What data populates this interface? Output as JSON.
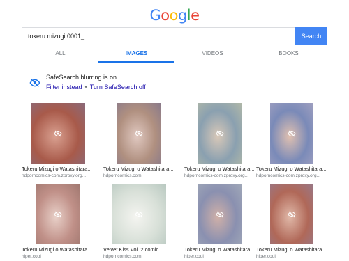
{
  "logo": {
    "letters": [
      "G",
      "o",
      "o",
      "g",
      "l",
      "e"
    ],
    "colors": [
      "#4285f4",
      "#ea4335",
      "#fbbc05",
      "#4285f4",
      "#34a853",
      "#ea4335"
    ]
  },
  "search": {
    "query": "tokeru mizugi 0001_",
    "button_label": "Search"
  },
  "tabs": [
    {
      "label": "ALL"
    },
    {
      "label": "IMAGES"
    },
    {
      "label": "VIDEOS"
    },
    {
      "label": "BOOKS"
    }
  ],
  "safesearch": {
    "title": "SafeSearch blurring is on",
    "filter_link": "Filter instead",
    "separator": "•",
    "turn_off_link": "Turn SafeSearch off"
  },
  "results": [
    {
      "title": "Tokeru Mizugi o Watashitara...",
      "source": "hdporncomics-com.zproxy.org...",
      "colors": [
        "#a85a4a",
        "#d9a090",
        "#8a6a7a"
      ]
    },
    {
      "title": "Tokeru Mizugi o Watashitara...",
      "source": "hdporncomics.com",
      "colors": [
        "#b09080",
        "#e0c8c0",
        "#8a7a8a"
      ]
    },
    {
      "title": "Tokeru Mizugi o Watashitara...",
      "source": "hdporncomics-com.zproxy.org...",
      "colors": [
        "#8aa0b0",
        "#d8c8b8",
        "#b0b8a8"
      ]
    },
    {
      "title": "Tokeru Mizugi o Watashitara...",
      "source": "hdporncomics-com.zproxy.org...",
      "colors": [
        "#7a8ab8",
        "#e0c0b0",
        "#a0a0c0"
      ]
    },
    {
      "title": "Tokeru Mizugi o Watashitara...",
      "source": "hiper.cool",
      "colors": [
        "#c09088",
        "#e8d0c8",
        "#a07870"
      ]
    },
    {
      "title": "Velvet Kiss Vol. 2 comic...",
      "source": "hdporncomics.com",
      "colors": [
        "#d8e0d8",
        "#f4f4f0",
        "#b8c8c0"
      ]
    },
    {
      "title": "Tokeru Mizugi o Watashitara...",
      "source": "hiper.cool",
      "colors": [
        "#8a90b0",
        "#d0b0a8",
        "#a0a8b8"
      ]
    },
    {
      "title": "Tokeru Mizugi o Watashitara...",
      "source": "hiper.cool",
      "colors": [
        "#b06858",
        "#e0b8a8",
        "#987888"
      ]
    }
  ]
}
